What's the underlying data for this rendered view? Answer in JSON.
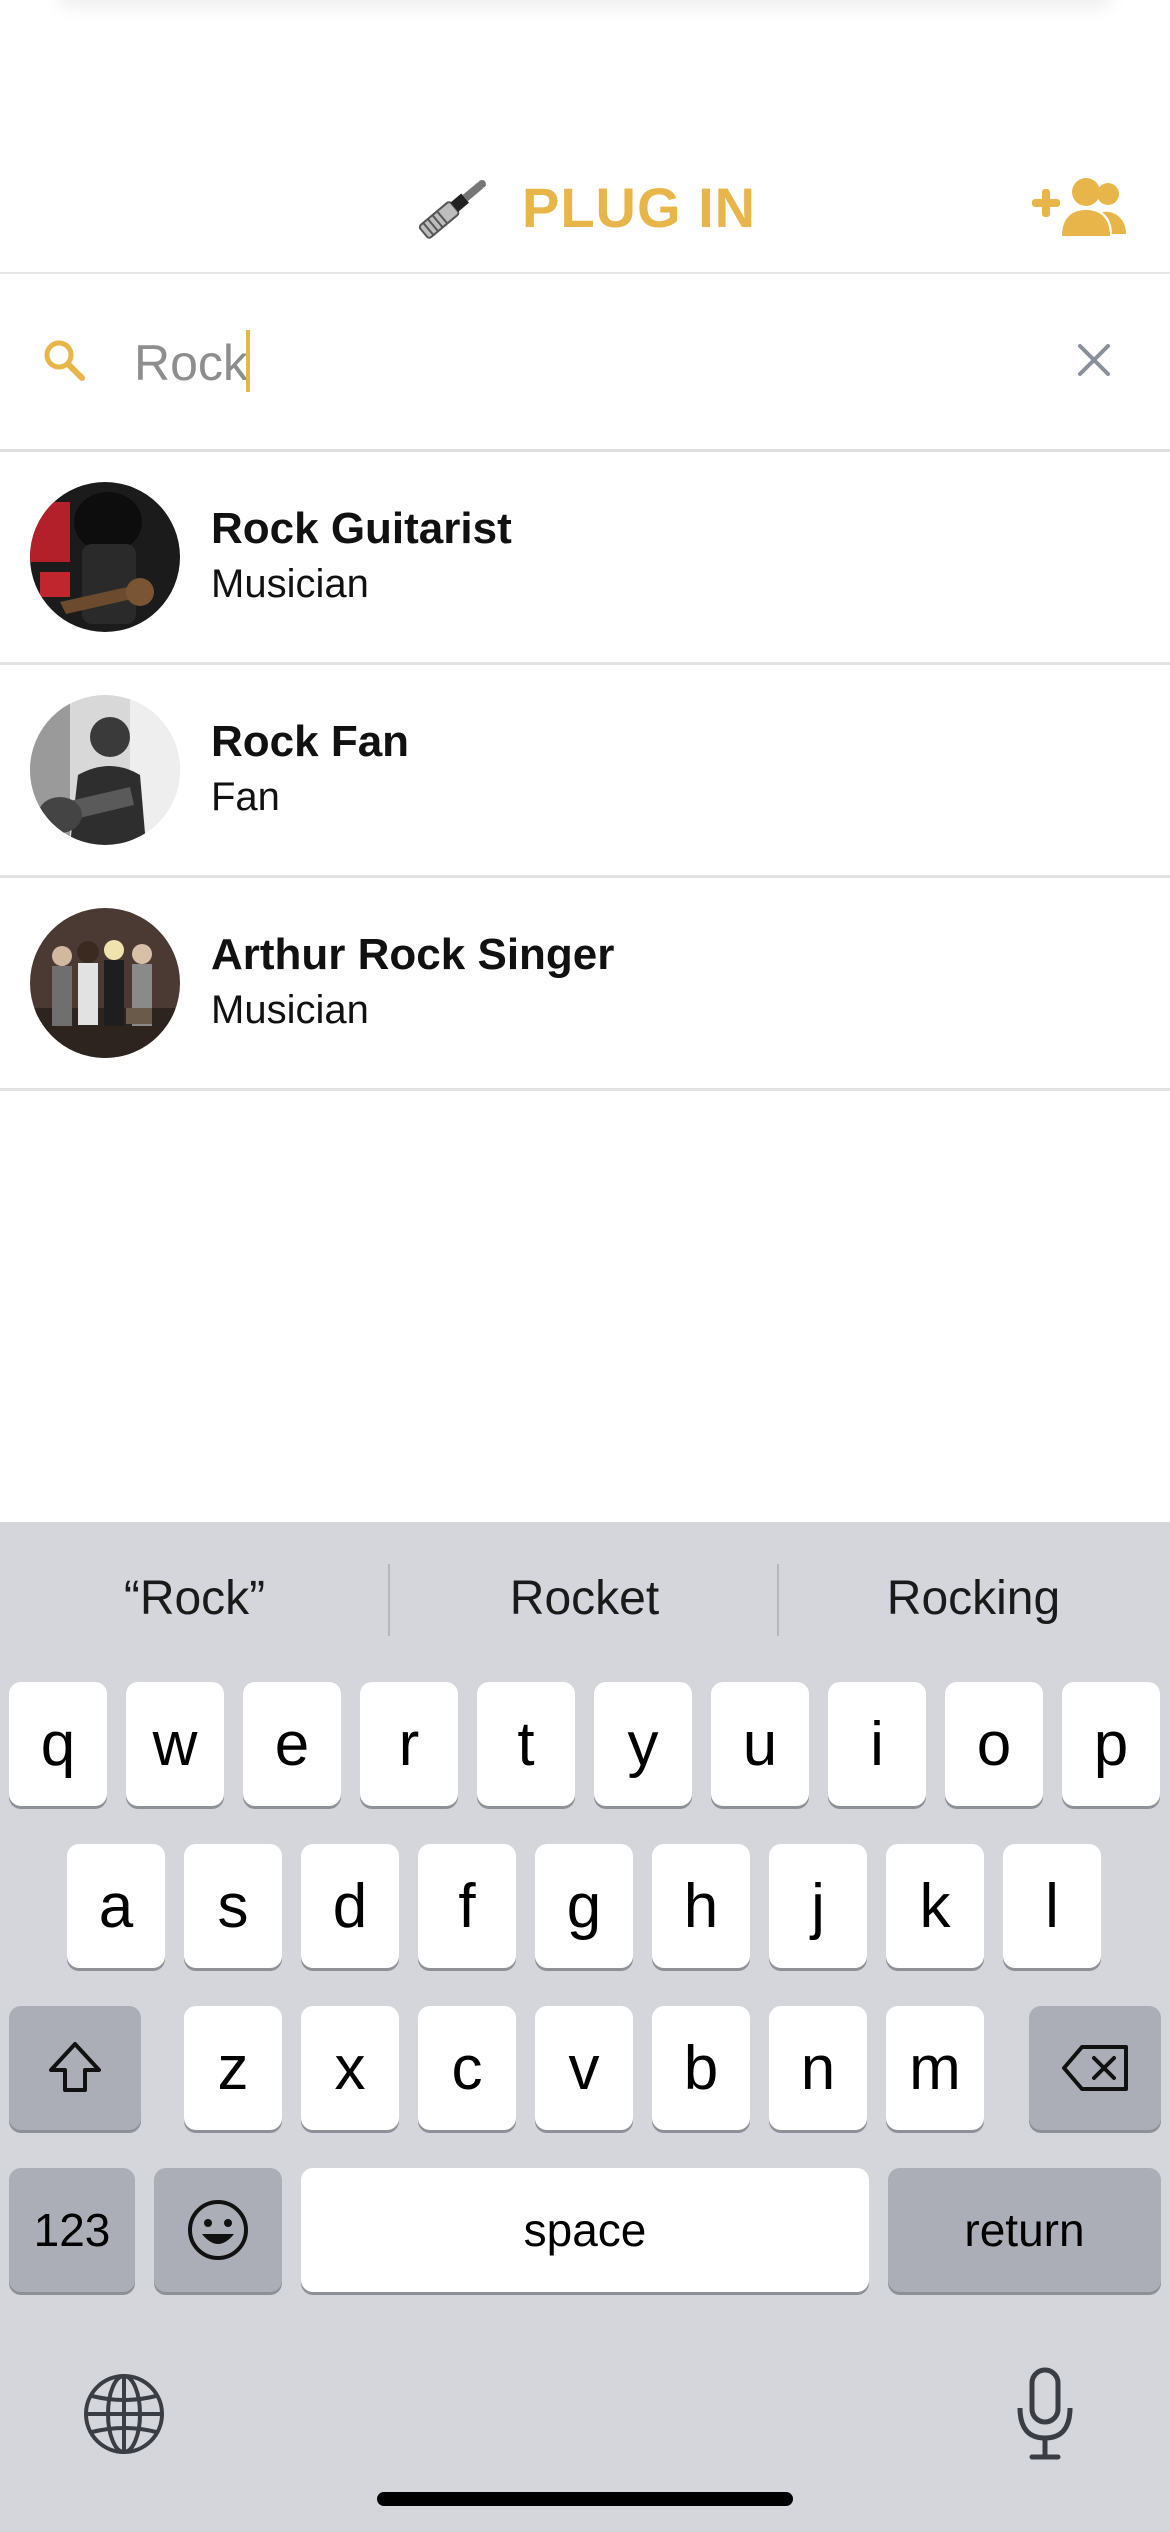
{
  "header": {
    "title": "PLUG IN",
    "logo_icon": "audio-jack-icon",
    "add_friend_icon": "add-people-icon",
    "accent_color": "#e8b54a"
  },
  "search": {
    "value": "Rock",
    "search_icon": "search-icon",
    "clear_icon": "close-icon"
  },
  "results": [
    {
      "name": "Rock Guitarist",
      "role": "Musician"
    },
    {
      "name": "Rock Fan",
      "role": "Fan"
    },
    {
      "name": "Arthur Rock Singer",
      "role": "Musician"
    }
  ],
  "keyboard": {
    "suggestions": [
      "“Rock”",
      "Rocket",
      "Rocking"
    ],
    "row1": [
      "q",
      "w",
      "e",
      "r",
      "t",
      "y",
      "u",
      "i",
      "o",
      "p"
    ],
    "row2": [
      "a",
      "s",
      "d",
      "f",
      "g",
      "h",
      "j",
      "k",
      "l"
    ],
    "row3": [
      "z",
      "x",
      "c",
      "v",
      "b",
      "n",
      "m"
    ],
    "numbers_label": "123",
    "space_label": "space",
    "return_label": "return"
  }
}
